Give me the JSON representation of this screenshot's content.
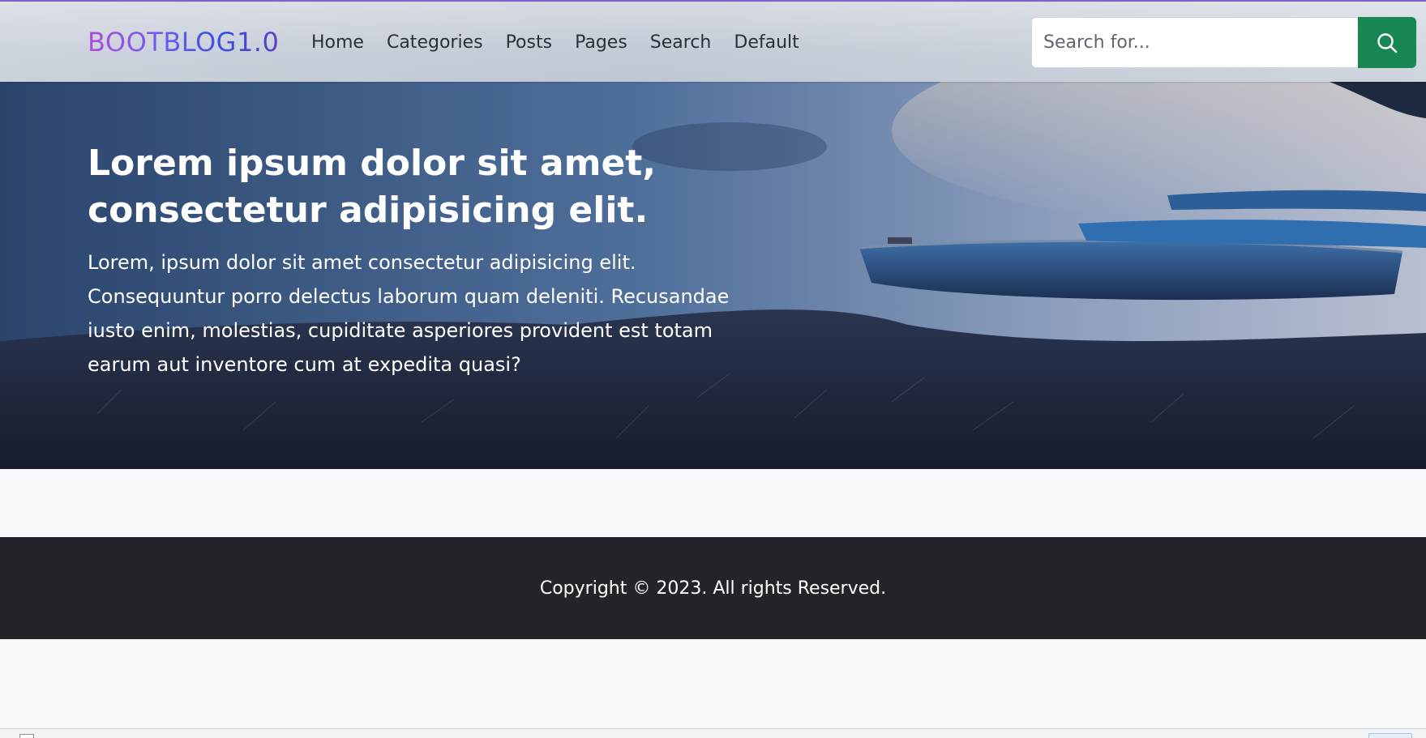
{
  "navbar": {
    "brand": "BOOTBLOG1.0",
    "links": [
      "Home",
      "Categories",
      "Posts",
      "Pages",
      "Search",
      "Default"
    ],
    "search": {
      "placeholder": "Search for...",
      "value": "",
      "button_icon": "search-icon"
    }
  },
  "hero": {
    "title": "Lorem ipsum dolor sit amet, consectetur adipisicing elit.",
    "text": "Lorem, ipsum dolor sit amet consectetur adipisicing elit. Consequuntur porro delectus laborum quam deleniti. Recusandae iusto enim, molestias, cupiditate asperiores provident est totam earum aut inventore cum at expedita quasi?",
    "background": "lake-with-boats-image"
  },
  "footer": {
    "copyright": "Copyright © 2023. All rights Reserved."
  },
  "colors": {
    "brand_gradient_start": "#b44bdb",
    "brand_gradient_end": "#3a4fe0",
    "search_button": "#198754",
    "footer_bg": "#212529",
    "page_bg": "#f8f9fa",
    "navbar_top_border": "#7e62c8"
  }
}
